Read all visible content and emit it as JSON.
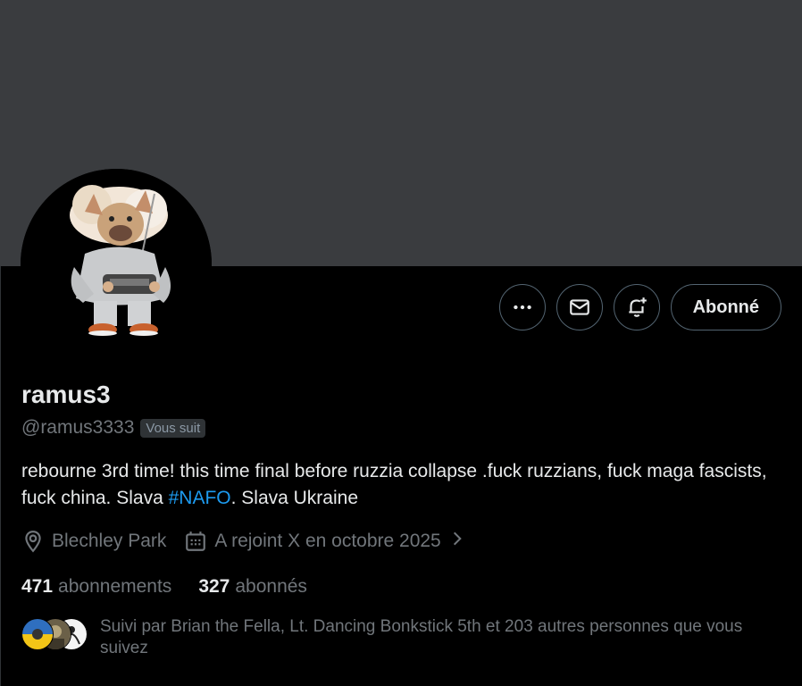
{
  "profile": {
    "display_name": "ramus3",
    "handle": "@ramus3333",
    "follows_you_badge": "Vous suit",
    "bio_part1": "rebourne 3rd time! this time final before ruzzia collapse .fuck ruzzians, fuck maga fascists, fuck china. Slava ",
    "bio_hashtag": "#NAFO",
    "bio_part2": ". Slava Ukraine",
    "location": "Blechley Park",
    "joined": "A rejoint X en octobre 2025"
  },
  "actions": {
    "more_icon": "more-horizontal-icon",
    "message_icon": "envelope-icon",
    "notify_icon": "bell-plus-icon",
    "follow_label": "Abonné"
  },
  "stats": {
    "following_count": "471",
    "following_label": "abonnements",
    "followers_count": "327",
    "followers_label": "abonnés"
  },
  "followed_by": {
    "text": "Suivi par Brian the Fella, Lt. Dancing Bonkstick 5th et 203 autres personnes que vous suivez"
  },
  "colors": {
    "banner": "#3a3c3f",
    "background": "#000000",
    "text_primary": "#e7e9ea",
    "text_secondary": "#71767b",
    "link": "#1d9bf0",
    "border": "#536471"
  }
}
